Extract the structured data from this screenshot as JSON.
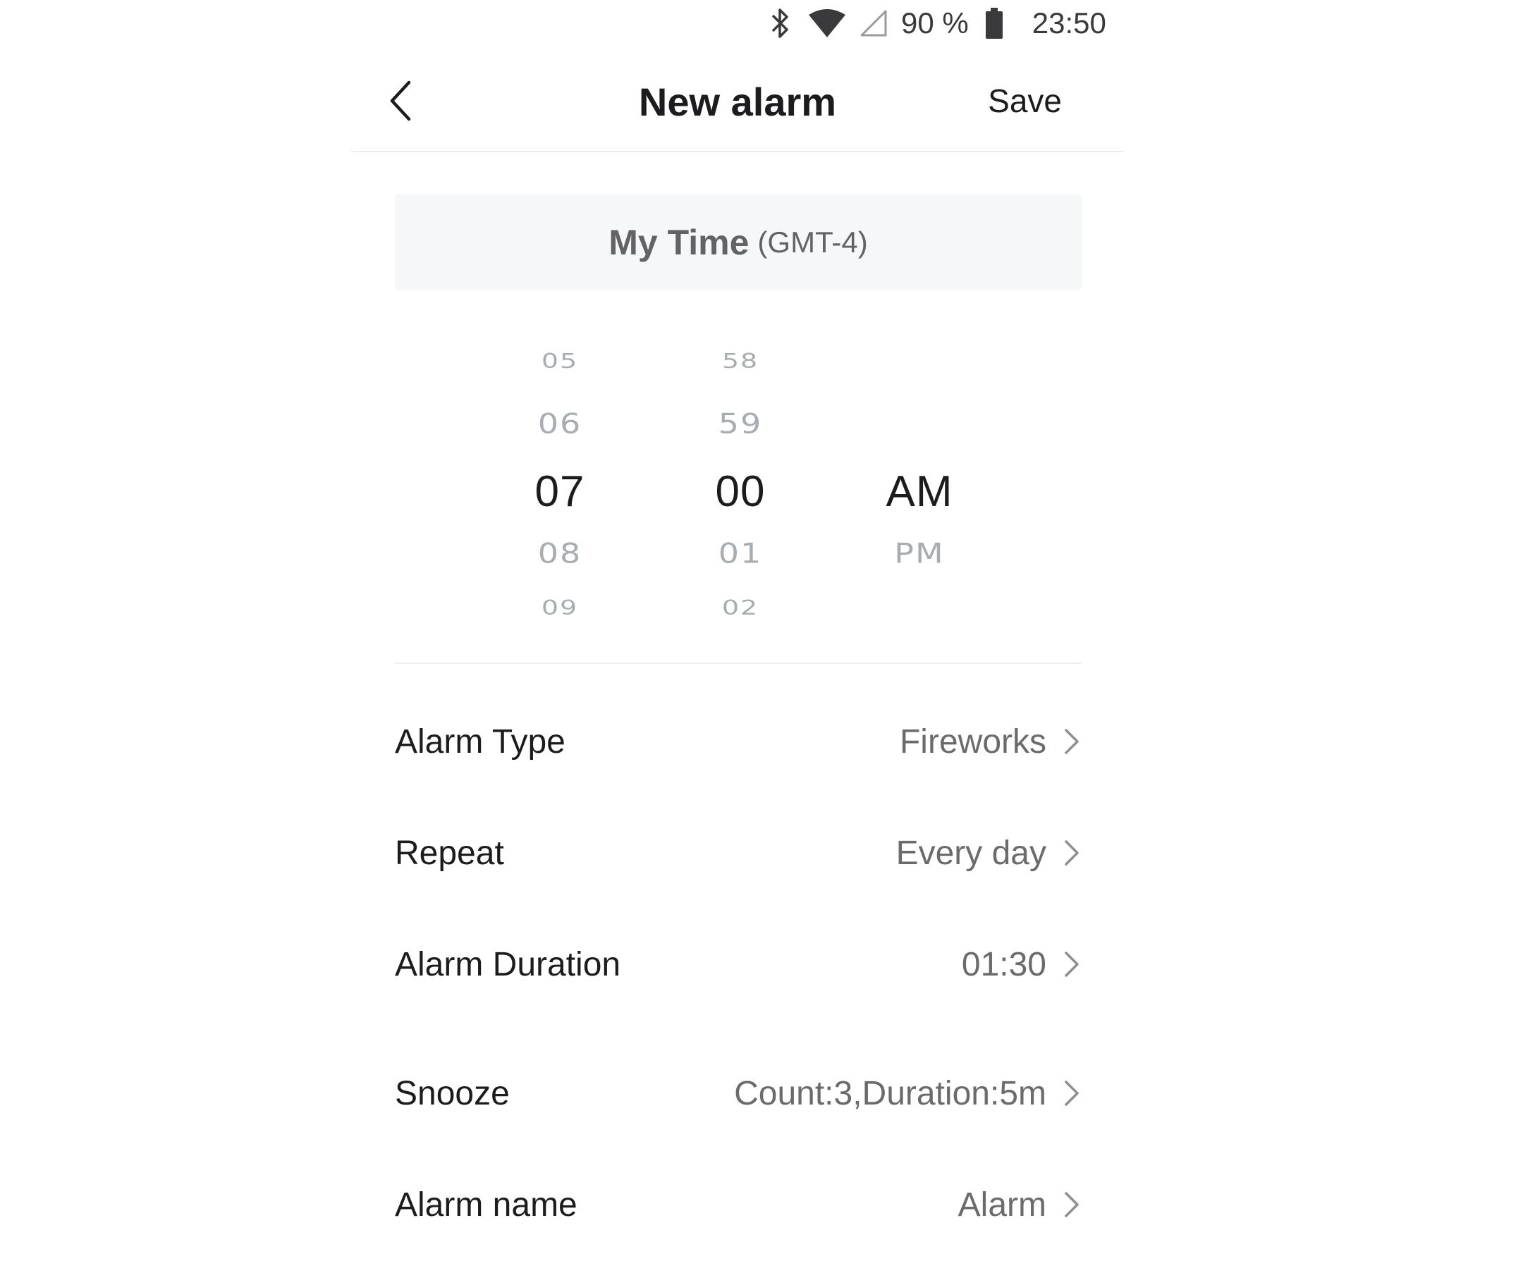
{
  "status_bar": {
    "icons": [
      "bluetooth-icon",
      "wifi-icon",
      "cell-signal-icon",
      "battery-icon"
    ],
    "battery_percent": "90 %",
    "time": "23:50"
  },
  "header": {
    "back_icon": "chevron-left-icon",
    "title": "New alarm",
    "save_label": "Save"
  },
  "timezone": {
    "label": "My Time",
    "offset": "(GMT-4)"
  },
  "picker": {
    "hours": [
      "05",
      "06",
      "07",
      "08",
      "09"
    ],
    "selected_hour": "07",
    "minutes": [
      "58",
      "59",
      "00",
      "01",
      "02"
    ],
    "selected_minute": "00",
    "periods": [
      "AM",
      "PM"
    ],
    "selected_period": "AM"
  },
  "settings": [
    {
      "label": "Alarm Type",
      "value": "Fireworks"
    },
    {
      "label": "Repeat",
      "value": "Every day"
    },
    {
      "label": "Alarm Duration",
      "value": "01:30"
    },
    {
      "label": "Snooze",
      "value": "Count:3,Duration:5m"
    },
    {
      "label": "Alarm name",
      "value": "Alarm"
    }
  ],
  "colors": {
    "text_primary": "#1c1c1e",
    "text_secondary": "#6b6b6e",
    "picker_inactive": "#a7adb0",
    "tz_background": "#f6f7f8",
    "divider": "#ececec"
  }
}
